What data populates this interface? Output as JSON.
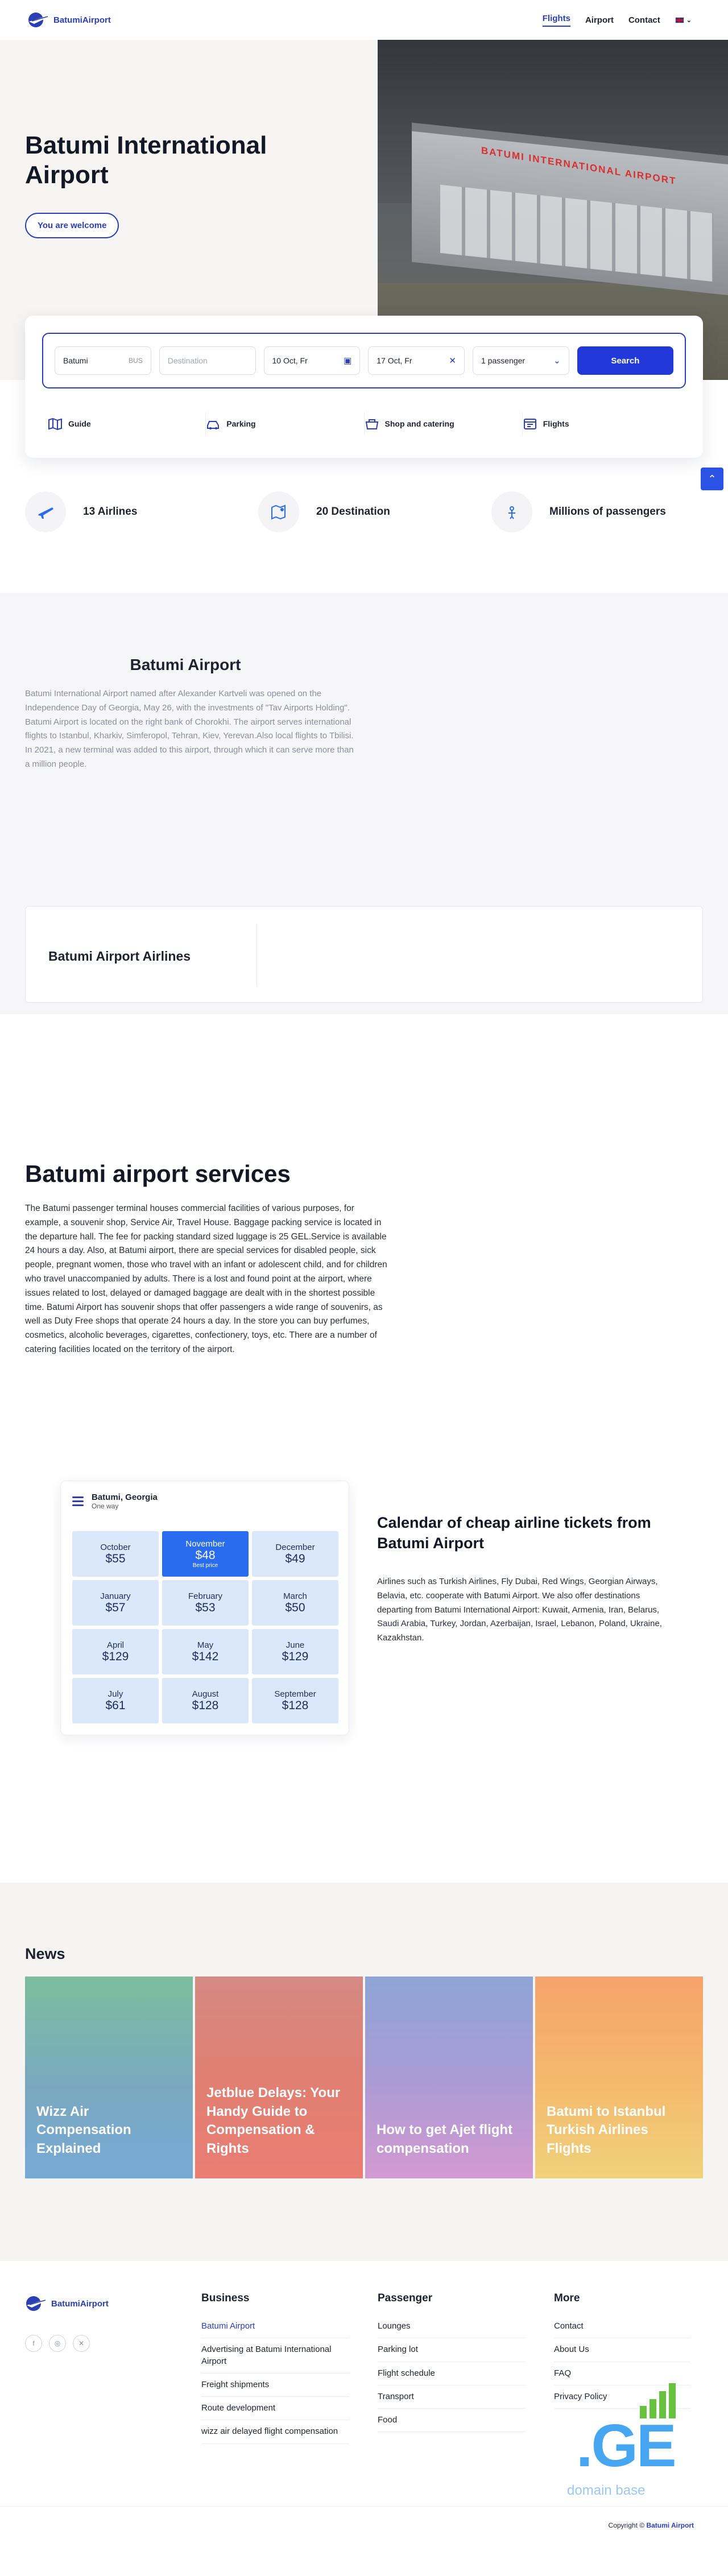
{
  "nav": {
    "logo": "BatumiAirport",
    "links": [
      "Flights",
      "Airport",
      "Contact"
    ],
    "lang": "EN"
  },
  "hero": {
    "title": "Batumi International Airport",
    "welcome": "You are welcome",
    "photo_sign": "BATUMI INTERNATIONAL AIRPORT"
  },
  "search": {
    "from_value": "Batumi",
    "from_code": "BUS",
    "to_placeholder": "Destination",
    "depart": "10 Oct, Fr",
    "return": "17 Oct, Fr",
    "passengers": "1 passenger",
    "button": "Search"
  },
  "quick_links": [
    "Guide",
    "Parking",
    "Shop and catering",
    "Flights"
  ],
  "stats": [
    "13 Airlines",
    "20 Destination",
    "Millions of passengers"
  ],
  "about": {
    "title": "Batumi Airport",
    "text": "Batumi International Airport named after Alexander Kartveli was opened on the Independence Day of Georgia, May 26, with the investments of \"Tav Airports Holding\". Batumi Airport is located on the right bank of Chorokhi. The airport serves international flights to Istanbul, Kharkiv, Simferopol, Tehran, Kiev, Yerevan.Also local flights to Tbilisi. In 2021, a new terminal was added to this airport, through which it can serve more than a million people.",
    "airlines_title": "Batumi Airport Airlines"
  },
  "services": {
    "title": "Batumi airport services",
    "text": "The Batumi passenger terminal houses commercial facilities of various purposes, for example, a souvenir shop, Service Air, Travel House. Baggage packing service is located in the departure hall. The fee for packing standard sized luggage is 25 GEL.Service is available 24 hours a day. Also, at Batumi airport, there are special services for disabled people, sick people, pregnant women, those who travel with an infant or adolescent child, and for children who travel unaccompanied by adults. There is a lost and found point at the airport, where issues related to lost, delayed or damaged baggage are dealt with in the shortest possible time. Batumi Airport has souvenir shops that offer passengers a wide range of souvenirs, as well as Duty Free shops that operate 24 hours a day. In the store you can buy perfumes, cosmetics, alcoholic beverages, cigarettes, confectionery, toys, etc. There are a number of catering facilities located on the territory of the airport."
  },
  "calendar": {
    "route": "Batumi, Georgia",
    "trip_type": "One way",
    "months": [
      {
        "month": "October",
        "price": "$55"
      },
      {
        "month": "November",
        "price": "$48",
        "tag": "Best price"
      },
      {
        "month": "December",
        "price": "$49"
      },
      {
        "month": "January",
        "price": "$57"
      },
      {
        "month": "February",
        "price": "$53"
      },
      {
        "month": "March",
        "price": "$50"
      },
      {
        "month": "April",
        "price": "$129"
      },
      {
        "month": "May",
        "price": "$142"
      },
      {
        "month": "June",
        "price": "$129"
      },
      {
        "month": "July",
        "price": "$61"
      },
      {
        "month": "August",
        "price": "$128"
      },
      {
        "month": "September",
        "price": "$128"
      }
    ],
    "title": "Calendar of cheap airline tickets from Batumi Airport",
    "text": "Airlines such as Turkish Airlines, Fly Dubai, Red Wings, Georgian Airways, Belavia, etc. cooperate with Batumi Airport. We also offer destinations departing from Batumi International Airport: Kuwait, Armenia, Iran, Belarus, Saudi Arabia, Turkey, Jordan, Azerbaijan, Israel, Lebanon, Poland, Ukraine, Kazakhstan."
  },
  "news": {
    "title": "News",
    "items": [
      "Wizz Air Compensation Explained",
      "Jetblue Delays: Your Handy Guide to Compensation & Rights",
      "How to get Ajet flight compensation",
      "Batumi to Istanbul Turkish Airlines Flights"
    ]
  },
  "footer": {
    "logo": "BatumiAirport",
    "socials": [
      "f",
      "◎",
      "✕"
    ],
    "business": {
      "title": "Business",
      "links": [
        "Batumi Airport",
        "Advertising at Batumi International Airport",
        "Freight shipments",
        "Route development",
        "wizz air delayed flight compensation"
      ]
    },
    "passenger": {
      "title": "Passenger",
      "links": [
        "Lounges",
        "Parking lot",
        "Flight schedule",
        "Transport",
        "Food"
      ]
    },
    "more": {
      "title": "More",
      "links": [
        "Contact",
        "About Us",
        "FAQ",
        "Privacy Policy"
      ]
    },
    "watermark_main": ".GE",
    "watermark_sub": "domain base",
    "copyright_prefix": "Copyright ©",
    "copyright_brand": "Batumi Airport"
  },
  "colors": {
    "brand": "#2a3fb3",
    "search_button": "#2238d8",
    "best_price": "#2a6cf0",
    "calendar_cell": "#dbe7fb"
  }
}
